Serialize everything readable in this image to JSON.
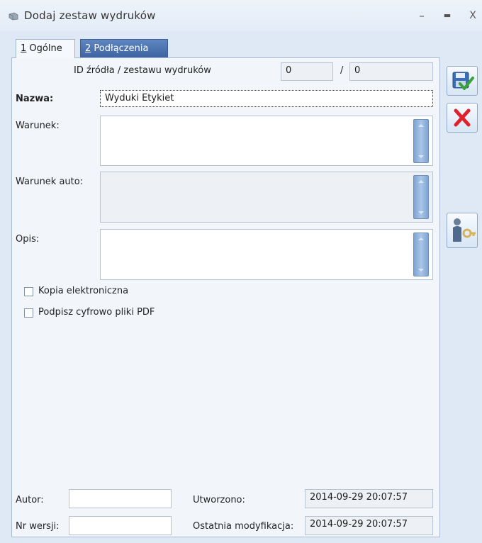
{
  "window": {
    "title": "Dodaj zestaw wydruków",
    "minimize_glyph": "–",
    "maximize_glyph": "▬",
    "close_glyph": "X"
  },
  "tabs": [
    {
      "number": "1",
      "label": " Ogólne"
    },
    {
      "number": "2",
      "label": " Podłączenia"
    }
  ],
  "form": {
    "id_label": "ID źródła / zestawu wydruków",
    "id_source": "0",
    "id_separator": "/",
    "id_set": "0",
    "name_label": "Nazwa:",
    "name_value": "Wyduki Etykiet",
    "condition_label": "Warunek:",
    "condition_value": "",
    "auto_condition_label": "Warunek auto:",
    "auto_condition_value": "",
    "description_label": "Opis:",
    "description_value": "",
    "checkbox_copy_label": "Kopia elektroniczna",
    "checkbox_copy_checked": false,
    "checkbox_sign_label": "Podpisz cyfrowo pliki PDF",
    "checkbox_sign_checked": false,
    "author_label": "Autor:",
    "author_value": "",
    "version_label": "Nr wersji:",
    "version_value": "",
    "created_label": "Utworzono:",
    "created_value": "2014-09-29 20:07:57",
    "modified_label": "Ostatnia modyfikacja:",
    "modified_value": "2014-09-29 20:07:57"
  },
  "toolbar": {
    "save_icon": "save-icon",
    "cancel_icon": "cancel-icon",
    "user_icon": "user-key-icon"
  },
  "colors": {
    "background": "#dfe9f5",
    "panel": "#f2f6fb",
    "active_tab_blue": "#3c63a0",
    "cancel_red": "#e0202a",
    "save_green": "#3aa23a"
  }
}
